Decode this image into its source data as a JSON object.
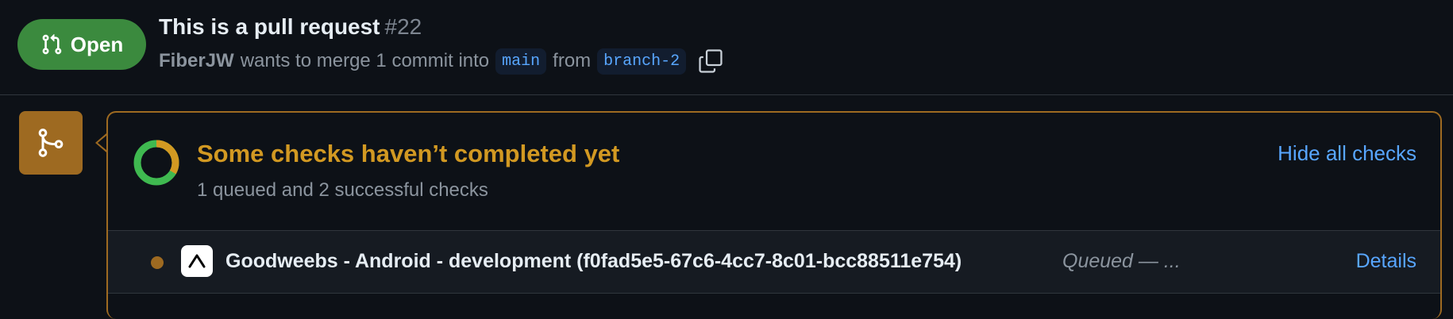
{
  "pr": {
    "state_label": "Open",
    "title": "This is a pull request",
    "number": "#22",
    "author": "FiberJW",
    "merge_text": "wants to merge 1 commit into",
    "base_branch": "main",
    "from_text": "from",
    "head_branch": "branch-2",
    "state_icon": "git-pull-request-icon",
    "copy_icon": "copy-icon"
  },
  "checks": {
    "title": "Some checks haven’t completed yet",
    "summary": "1 queued and 2 successful checks",
    "hide_label": "Hide all checks",
    "donut": {
      "successful": 2,
      "queued": 1,
      "success_color": "#3fb950",
      "queued_color": "#d29922"
    },
    "icon": "git-merge-icon",
    "rows": [
      {
        "name": "Goodweebs - Android - development (f0fad5e5-67c6-4cc7-8c01-bcc88511e754)",
        "status": "Queued — ...",
        "details_label": "Details",
        "app_icon": "expo-logo-icon",
        "status_icon": "queued-dot-icon"
      }
    ]
  },
  "colors": {
    "open_green": "#3b8a3e",
    "pending_amber": "#d29922",
    "pending_box": "#9e6a21",
    "link_blue": "#58a6ff",
    "background": "#0d1117"
  }
}
